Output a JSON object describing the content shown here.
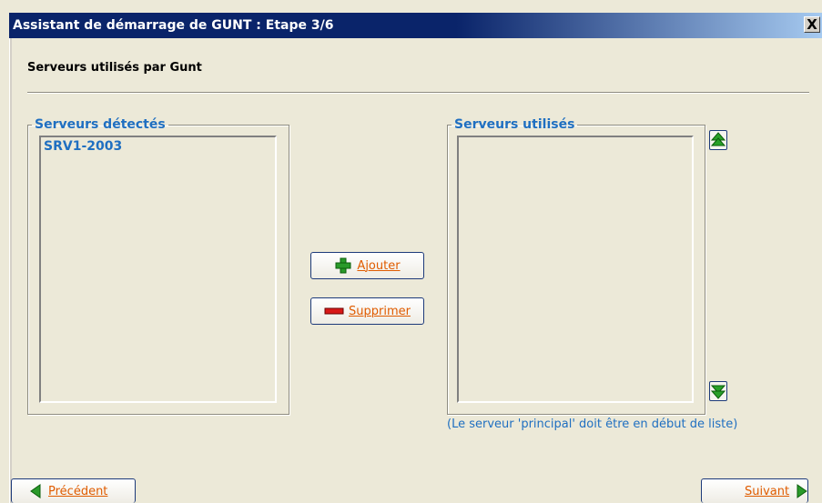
{
  "window": {
    "title": "Assistant de démarrage de GUNT : Etape 3/6",
    "close_label": "X"
  },
  "page": {
    "subtitle": "Serveurs utilisés par Gunt"
  },
  "detected": {
    "legend": "Serveurs détectés",
    "items": [
      "SRV1-2003"
    ]
  },
  "used": {
    "legend": "Serveurs utilisés",
    "items": []
  },
  "actions": {
    "add_label": "Ajouter",
    "remove_label": "Supprimer"
  },
  "note": "(Le serveur 'principal' doit être en début de liste)",
  "nav": {
    "prev_label": "Précédent",
    "next_label": "Suivant"
  },
  "colors": {
    "accent": "#1f6fc1",
    "button_text": "#e05c00",
    "titlebar": "#0a246a",
    "background": "#ece9d8"
  }
}
